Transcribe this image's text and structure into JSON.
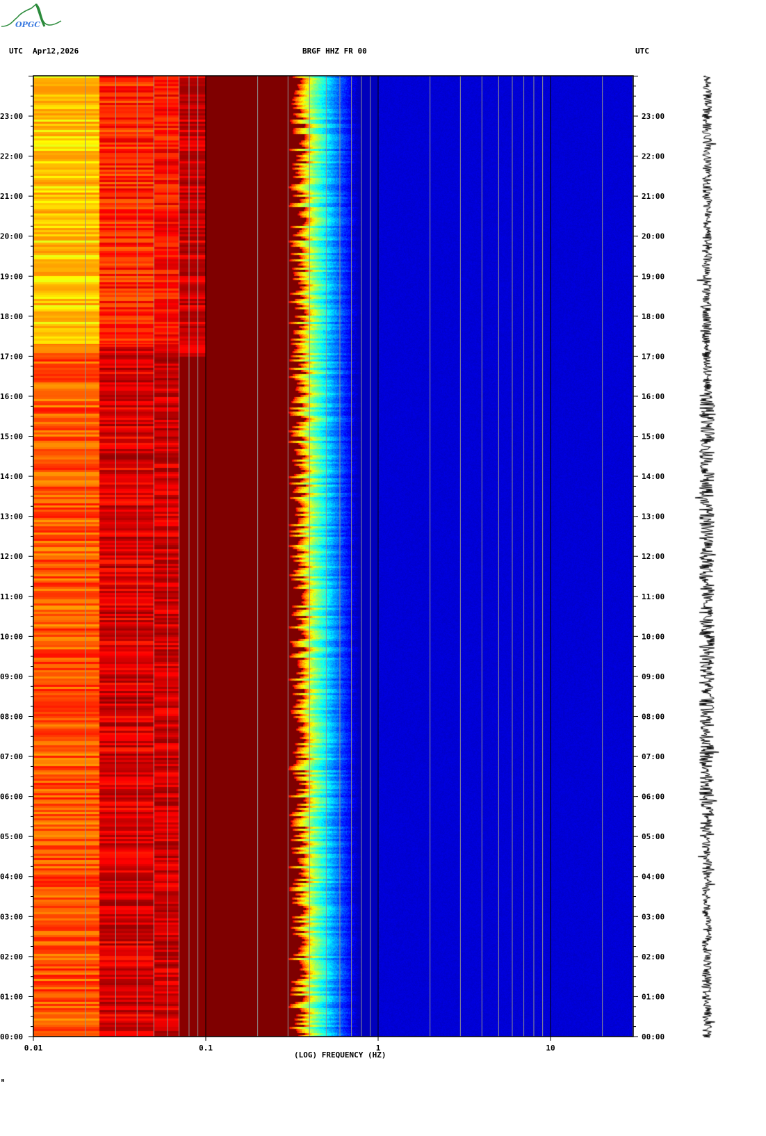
{
  "header": {
    "left_tz": "UTC",
    "date": "Apr12,2026",
    "station": "BRGF HHZ FR 00",
    "right_tz": "UTC"
  },
  "logo": {
    "text": "OPGC"
  },
  "footer_mark": "ᴍ",
  "chart_data": {
    "type": "heatmap",
    "title": "BRGF HHZ FR 00",
    "xlabel": "(LOG) FREQUENCY (HZ)",
    "x_scale": "log",
    "xlim": [
      0.01,
      30
    ],
    "x_ticks": [
      "0.01",
      "0.1",
      "1",
      "10"
    ],
    "ylim": [
      "00:00",
      "24:00"
    ],
    "y_ticks": [
      "00:00",
      "01:00",
      "02:00",
      "03:00",
      "04:00",
      "05:00",
      "06:00",
      "07:00",
      "08:00",
      "09:00",
      "10:00",
      "11:00",
      "12:00",
      "13:00",
      "14:00",
      "15:00",
      "16:00",
      "17:00",
      "18:00",
      "19:00",
      "20:00",
      "21:00",
      "22:00",
      "23:00"
    ],
    "colormap": "jet",
    "bands": [
      {
        "freq_hz": [
          0.01,
          0.024
        ],
        "level": "yellow-orange, green-cyan after 17:00"
      },
      {
        "freq_hz": [
          0.024,
          0.05
        ],
        "level": "orange to dark red"
      },
      {
        "freq_hz": [
          0.05,
          0.07
        ],
        "level": "red-orange"
      },
      {
        "freq_hz": [
          0.07,
          0.1
        ],
        "level": "dark red"
      },
      {
        "freq_hz": [
          0.1,
          0.3
        ],
        "level": "dark red (maximum)"
      },
      {
        "freq_hz": [
          0.3,
          0.6
        ],
        "level": "red to yellow to cyan"
      },
      {
        "freq_hz": [
          0.6,
          30
        ],
        "level": "dark blue (minimum)"
      }
    ],
    "grid": true,
    "colors": {
      "max": "#800000",
      "min": "#00009a",
      "grid": "#909090"
    }
  }
}
